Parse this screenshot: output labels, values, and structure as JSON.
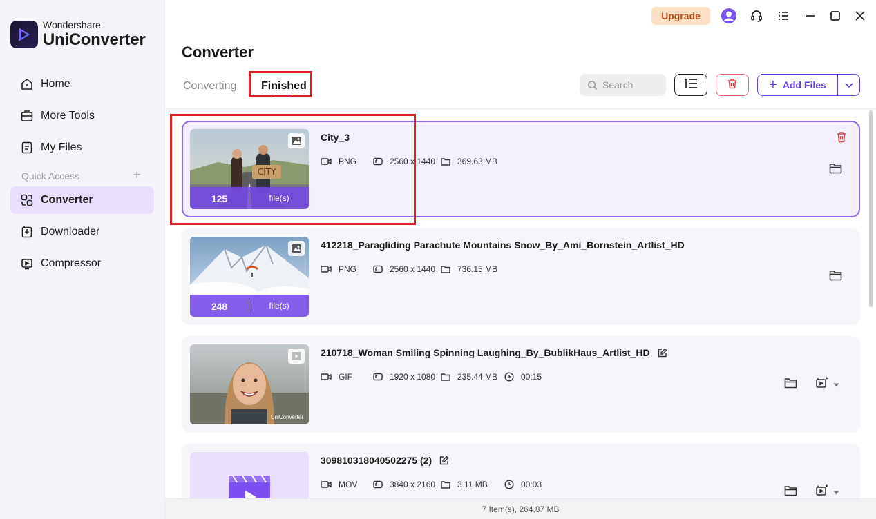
{
  "app": {
    "brand": "Wondershare",
    "product": "UniConverter"
  },
  "sidebar": {
    "items": [
      {
        "label": "Home",
        "icon": "home-icon"
      },
      {
        "label": "More Tools",
        "icon": "toolbox-icon"
      },
      {
        "label": "My Files",
        "icon": "file-icon"
      },
      {
        "label": "Converter",
        "icon": "converter-icon",
        "active": true
      },
      {
        "label": "Downloader",
        "icon": "download-icon"
      },
      {
        "label": "Compressor",
        "icon": "compress-icon"
      }
    ],
    "quick_access_label": "Quick Access",
    "quick_access_add": "+"
  },
  "topbar": {
    "upgrade_label": "Upgrade"
  },
  "page": {
    "title": "Converter",
    "tabs": [
      {
        "label": "Converting",
        "active": false
      },
      {
        "label": "Finished",
        "active": true
      }
    ]
  },
  "toolbar": {
    "search_placeholder": "Search",
    "add_files_label": "Add Files"
  },
  "files": [
    {
      "name": "City_3",
      "format": "PNG",
      "resolution": "2560 x 1440",
      "size": "369.63 MB",
      "duration": "",
      "count": "125",
      "count_unit": "file(s)",
      "type": "image",
      "selected": true
    },
    {
      "name": "412218_Paragliding Parachute Mountains Snow_By_Ami_Bornstein_Artlist_HD",
      "format": "PNG",
      "resolution": "2560 x 1440",
      "size": "736.15 MB",
      "duration": "",
      "count": "248",
      "count_unit": "file(s)",
      "type": "image",
      "selected": false
    },
    {
      "name": "210718_Woman Smiling Spinning Laughing_By_BublikHaus_Artlist_HD",
      "format": "GIF",
      "resolution": "1920 x 1080",
      "size": "235.44 MB",
      "duration": "00:15",
      "type": "video",
      "watermark": "UniConverter",
      "selected": false
    },
    {
      "name": "309810318040502275 (2)",
      "format": "MOV",
      "resolution": "3840 x 2160",
      "size": "3.11 MB",
      "duration": "00:03",
      "type": "video",
      "selected": false
    }
  ],
  "footer": {
    "summary": "7 Item(s), 264.87 MB"
  },
  "colors": {
    "accent": "#6a3df0",
    "highlight": "#e0212a",
    "upgrade_bg": "#fde0c4",
    "delete": "#e5484d"
  }
}
